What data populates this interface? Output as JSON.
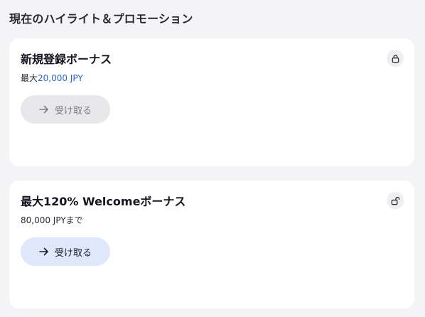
{
  "section": {
    "title": "現在のハイライト＆プロモーション"
  },
  "promotions": [
    {
      "title": "新規登録ボーナス",
      "subtitle_prefix": "最大",
      "subtitle_highlight": "20,000 JPY",
      "subtitle_suffix": "",
      "lock_icon": "lock-closed-icon",
      "button_label": "受け取る",
      "button_state": "disabled"
    },
    {
      "title": "最大120% Welcomeボーナス",
      "subtitle_prefix": "80,000 JPYまで",
      "subtitle_highlight": "",
      "subtitle_suffix": "",
      "lock_icon": "lock-open-icon",
      "button_label": "受け取る",
      "button_state": "active"
    }
  ],
  "colors": {
    "background": "#f4f4f6",
    "card": "#ffffff",
    "highlight": "#2b63c9",
    "button_disabled_bg": "#e8e8ea",
    "button_active_bg": "#dfe8fb"
  }
}
